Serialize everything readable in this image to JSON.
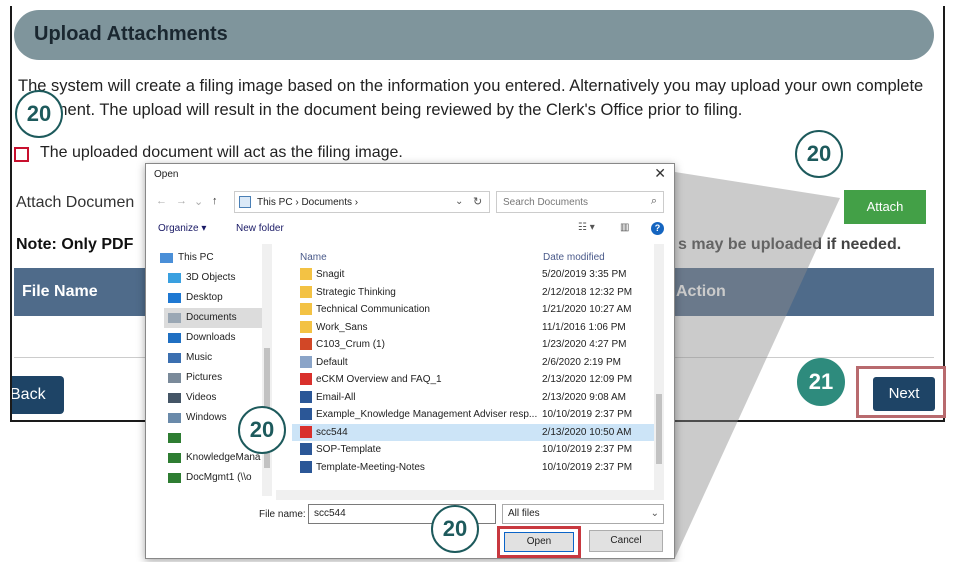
{
  "page": {
    "title": "Upload Attachments",
    "intro": "The system will create a filing image based on the information you entered. Alternatively you may upload your own complete document. The upload will result in the document being reviewed by the Clerk's Office prior to filing.",
    "checkbox_label": "The uploaded document will act as the filing image.",
    "attach_label": "Attach Documen",
    "attach_button": "Attach",
    "note_left": "Note: Only PDF",
    "note_right": "s may be uploaded if needed.",
    "table": {
      "col_file": "File Name",
      "col_action": "Action"
    },
    "back_button": "Back",
    "next_button": "Next"
  },
  "callouts": {
    "a": "20",
    "b": "20",
    "c": "21",
    "d": "20",
    "e": "20"
  },
  "dialog": {
    "title": "Open",
    "close": "✕",
    "address": "This PC  ›  Documents  ›",
    "search_placeholder": "Search Documents",
    "toolbar": {
      "organize": "Organize ▾",
      "new_folder": "New folder"
    },
    "nav": [
      {
        "label": "This PC",
        "icon": "pc-icon"
      },
      {
        "label": "3D Objects",
        "icon": "3d-objects-icon"
      },
      {
        "label": "Desktop",
        "icon": "desktop-icon"
      },
      {
        "label": "Documents",
        "icon": "documents-icon"
      },
      {
        "label": "Downloads",
        "icon": "downloads-icon"
      },
      {
        "label": "Music",
        "icon": "music-icon"
      },
      {
        "label": "Pictures",
        "icon": "pictures-icon"
      },
      {
        "label": "Videos",
        "icon": "videos-icon"
      },
      {
        "label": "Windows",
        "icon": "drive-icon"
      },
      {
        "label": "",
        "icon": "network-drive-icon"
      },
      {
        "label": "KnowledgeMana",
        "icon": "network-drive-icon"
      },
      {
        "label": "DocMgmt1 (\\\\o",
        "icon": "network-drive-icon"
      }
    ],
    "list_header": {
      "name": "Name",
      "date": "Date modified"
    },
    "files": [
      {
        "name": "Snagit",
        "date": "5/20/2019 3:35 PM",
        "type": "folder"
      },
      {
        "name": "Strategic Thinking",
        "date": "2/12/2018 12:32 PM",
        "type": "folder"
      },
      {
        "name": "Technical Communication",
        "date": "1/21/2020 10:27 AM",
        "type": "folder"
      },
      {
        "name": "Work_Sans",
        "date": "11/1/2016 1:06 PM",
        "type": "folder"
      },
      {
        "name": "C103_Crum (1)",
        "date": "1/23/2020 4:27 PM",
        "type": "ppt"
      },
      {
        "name": "Default",
        "date": "2/6/2020 2:19 PM",
        "type": "generic"
      },
      {
        "name": "eCKM Overview and FAQ_1",
        "date": "2/13/2020 12:09 PM",
        "type": "pdf"
      },
      {
        "name": "Email-All",
        "date": "2/13/2020 9:08 AM",
        "type": "word"
      },
      {
        "name": "Example_Knowledge Management Adviser resp...",
        "date": "10/10/2019 2:37 PM",
        "type": "word"
      },
      {
        "name": "scc544",
        "date": "2/13/2020 10:50 AM",
        "type": "pdf",
        "selected": true
      },
      {
        "name": "SOP-Template",
        "date": "10/10/2019 2:37 PM",
        "type": "word"
      },
      {
        "name": "Template-Meeting-Notes",
        "date": "10/10/2019 2:37 PM",
        "type": "word"
      }
    ],
    "file_name_label": "File name:",
    "file_name_value": "scc544",
    "filter": "All files",
    "open_button": "Open",
    "cancel_button": "Cancel"
  },
  "colors": {
    "header_bar": "#7f959c",
    "table_header": "#4f6b8a",
    "nav_button": "#1e4466",
    "attach_green": "#43a047",
    "callout_teal": "#1d5a5c",
    "highlight_red": "#c8383f"
  }
}
